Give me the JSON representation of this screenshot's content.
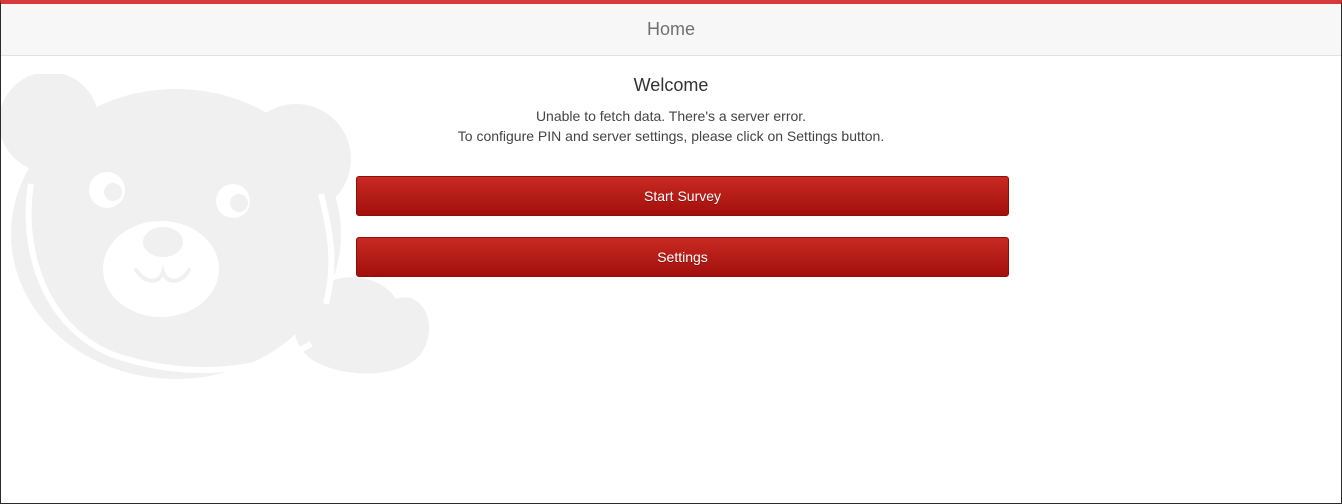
{
  "header": {
    "title": "Home"
  },
  "main": {
    "welcome": "Welcome",
    "message_line1": "Unable to fetch data. There's a server error.",
    "message_line2": "To configure PIN and server settings, please click on Settings button.",
    "start_survey_label": "Start Survey",
    "settings_label": "Settings"
  },
  "background": {
    "mascot_icon": "teddy-bear-icon"
  },
  "colors": {
    "top_accent": "#d63a3a",
    "button_top": "#c72a22",
    "button_bottom": "#a30f0c",
    "header_bg": "#f7f7f7",
    "mascot": "#f0f0f0"
  }
}
